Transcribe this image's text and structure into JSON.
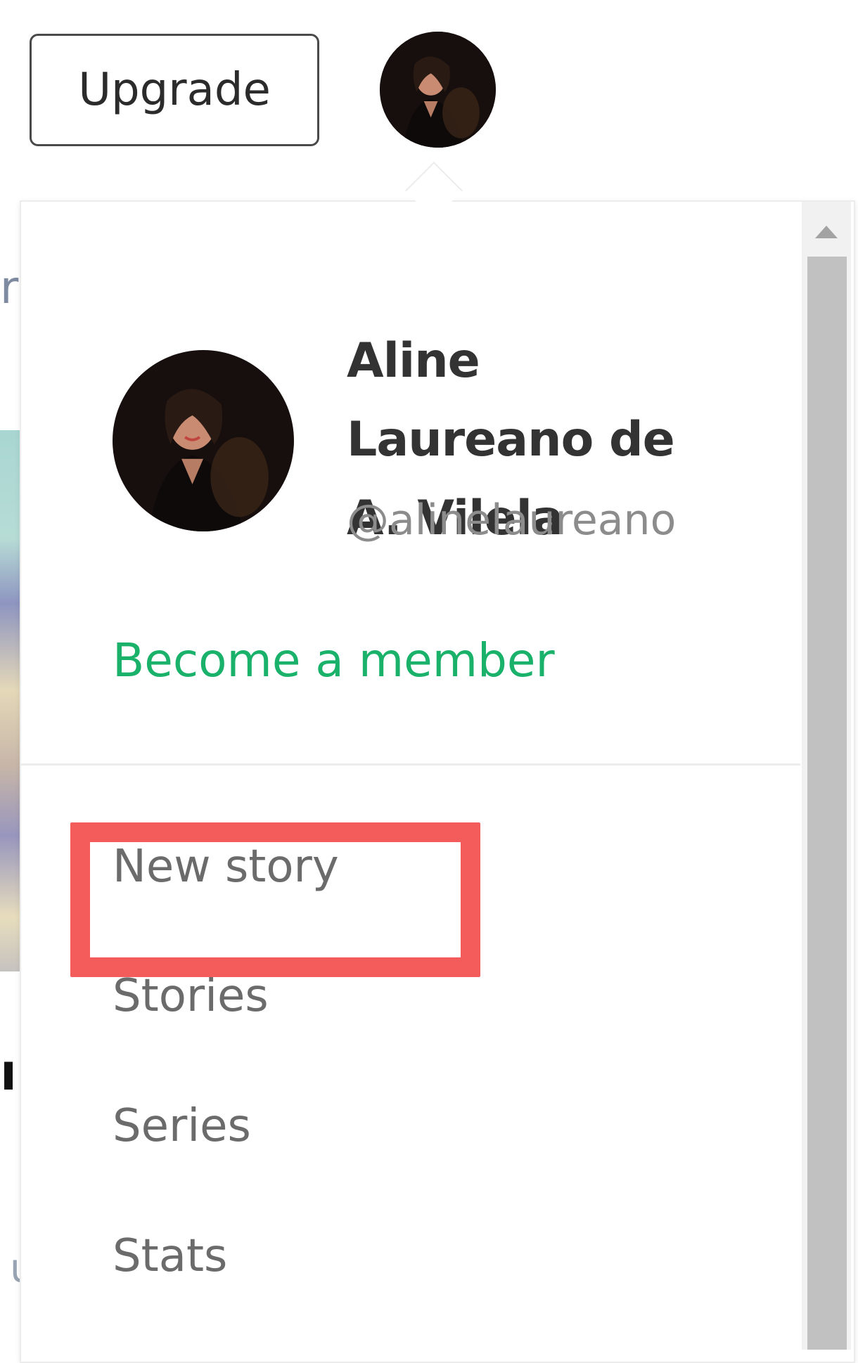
{
  "header": {
    "upgrade_label": "Upgrade"
  },
  "background_fragments": {
    "text_1": "rs",
    "text_2": "n",
    "text_3": "u"
  },
  "profile": {
    "name": "Aline Laureano de A. Vilela",
    "handle": "@alinelaureano",
    "become_member_label": "Become a member"
  },
  "menu": {
    "items": [
      {
        "label": "New story",
        "highlighted": true
      },
      {
        "label": "Stories"
      },
      {
        "label": "Series"
      },
      {
        "label": "Stats"
      }
    ]
  },
  "colors": {
    "accent_green": "#1ab26b",
    "highlight_red": "#f45b5b",
    "menu_text": "#6b6b6b",
    "name_text": "#333333",
    "handle_text": "#8c8c8c"
  },
  "icons": {
    "scroll_up": "triangle-up-icon"
  }
}
